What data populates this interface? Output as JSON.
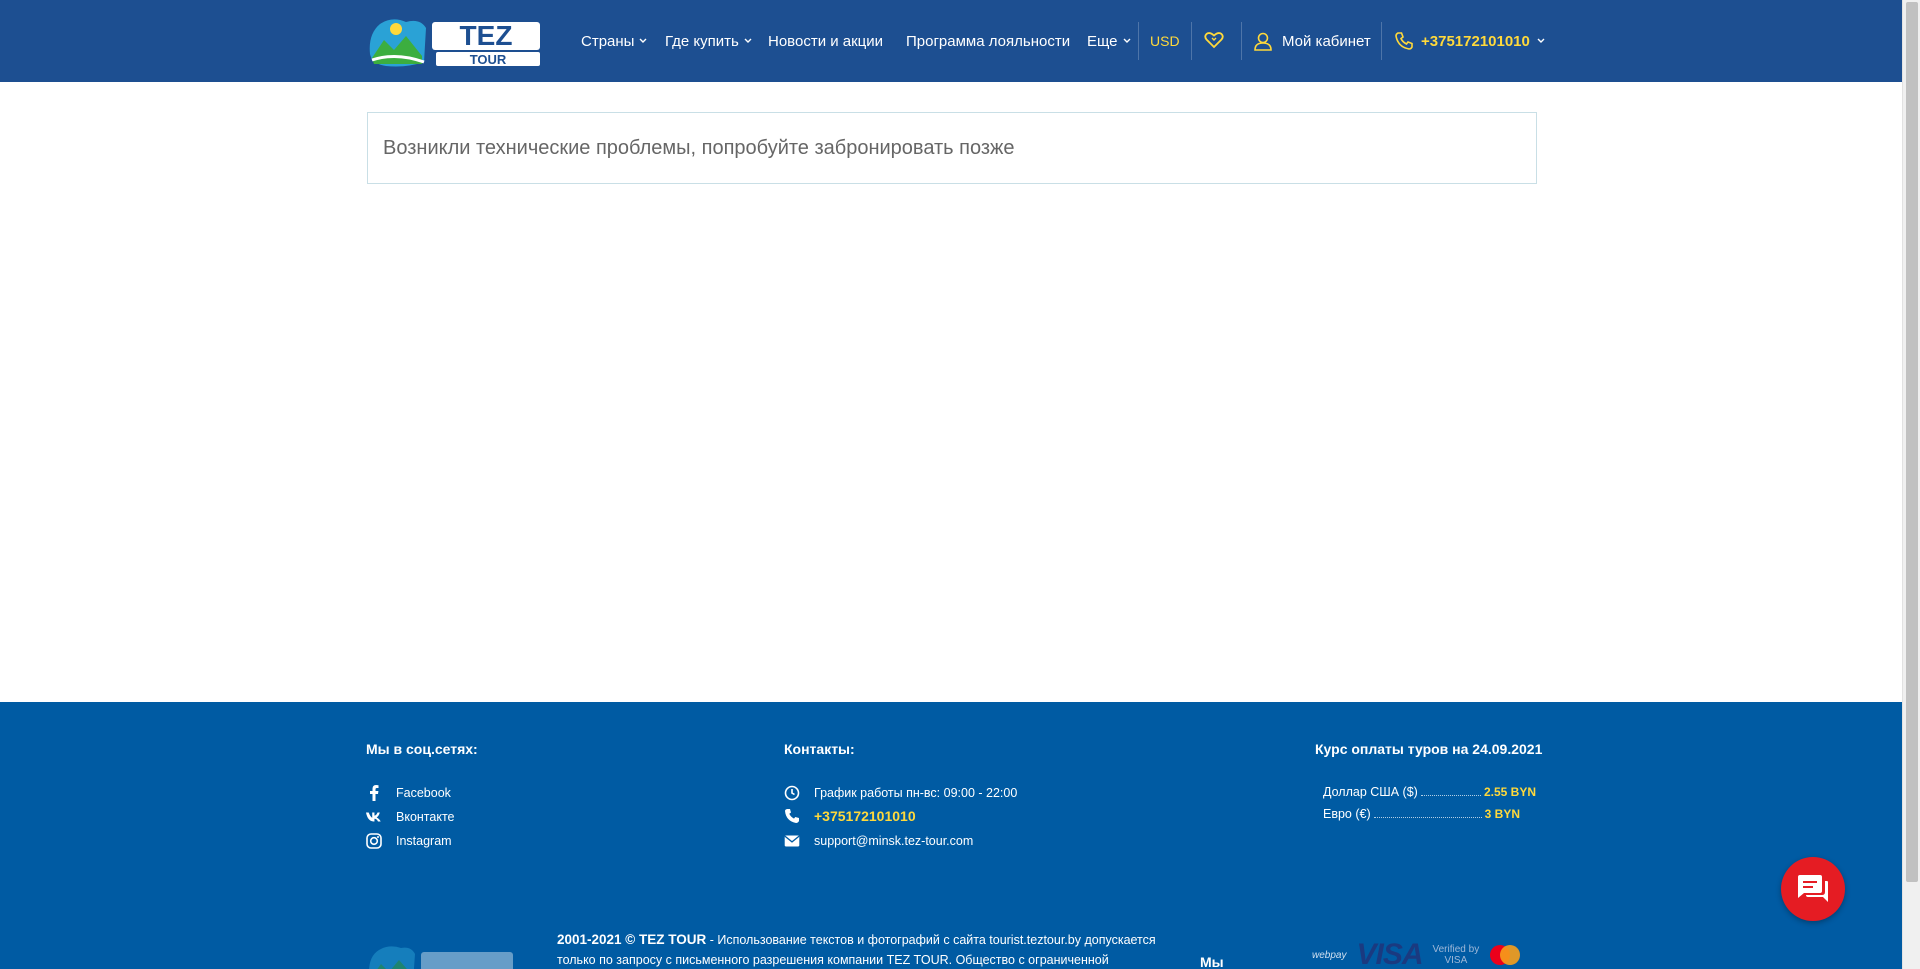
{
  "header": {
    "logo_text_top": "TEZ",
    "logo_text_bottom": "TOUR",
    "nav": {
      "countries": "Страны",
      "where_to_buy": "Где купить",
      "news": "Новости и акции",
      "loyalty": "Программа лояльности",
      "more": "Еще"
    },
    "currency": "USD",
    "cabinet": "Мой кабинет",
    "phone": "+375172101010"
  },
  "main": {
    "error_message": "Возникли технические проблемы, попробуйте забронировать позже"
  },
  "footer": {
    "social": {
      "title": "Мы в соц.сетях:",
      "items": [
        "Facebook",
        "Вконтакте",
        "Instagram"
      ]
    },
    "contacts": {
      "title": "Контакты:",
      "hours": "График работы пн-вс: 09:00 - 22:00",
      "phone": "+375172101010",
      "email": "support@minsk.tez-tour.com"
    },
    "rates": {
      "title": "Курс оплаты туров на 24.09.2021",
      "items": [
        {
          "label": "Доллар США ($)",
          "value": "2.55 BYN"
        },
        {
          "label": "Евро (€)",
          "value": "3 BYN"
        }
      ]
    },
    "copyright_bold": "2001-2021 © TEZ TOUR",
    "copyright_text": " - Использование текстов и фотографий с сайта tourist.teztour.by допускается только по запросу с письменного разрешения компании TEZ TOUR. Общество с ограниченной",
    "my_label": "Мы",
    "payments": {
      "webpay": "webpay",
      "visa": "VISA",
      "vbv_top": "Verified by",
      "vbv_bottom": "VISA"
    }
  },
  "colors": {
    "header_bg": "#1d4f91",
    "footer_bg": "#005ba3",
    "accent_yellow": "#ffd93b",
    "chat_red": "#e51c23"
  }
}
